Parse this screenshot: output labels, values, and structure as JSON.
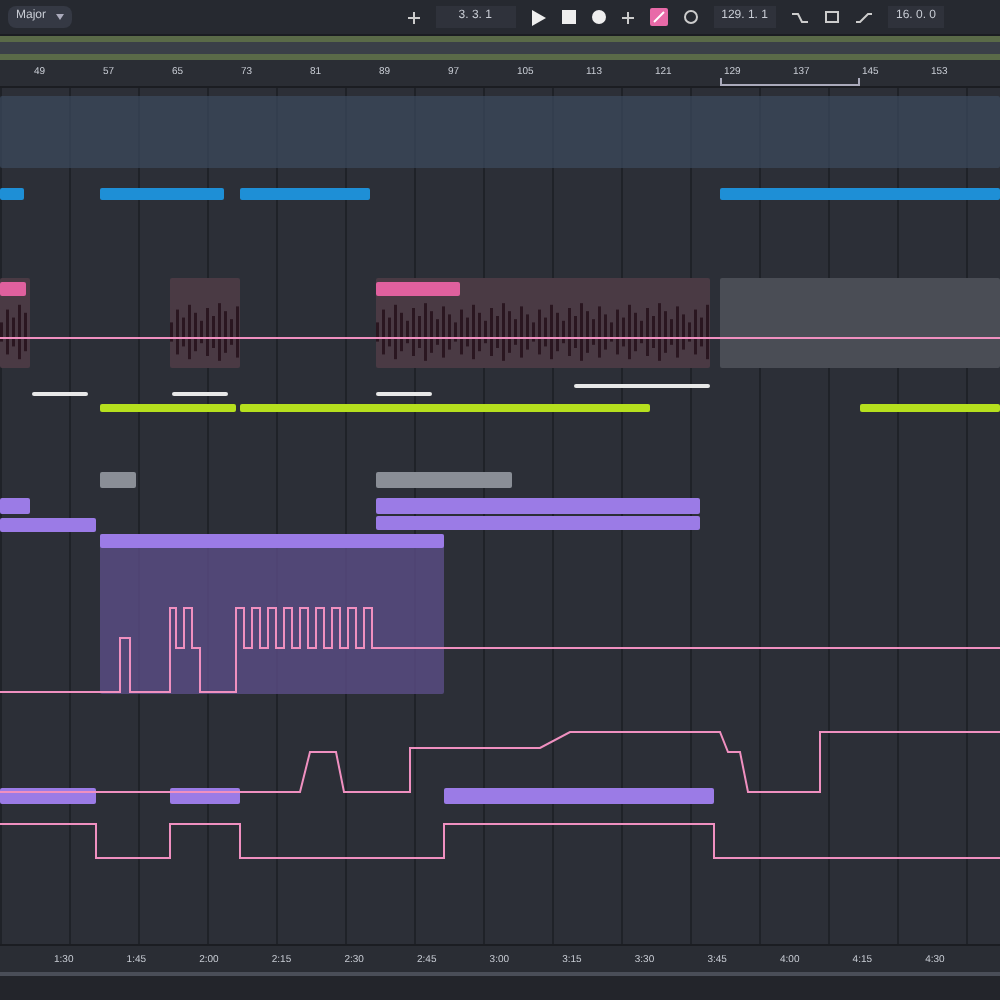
{
  "toolbar": {
    "scale": "Major",
    "position": "3. 3. 1",
    "loop_enabled": true,
    "loop_start": "129. 1. 1",
    "loop_length": "16. 0. 0"
  },
  "ruler": {
    "bars": [
      "49",
      "57",
      "65",
      "73",
      "81",
      "89",
      "97",
      "105",
      "113",
      "121",
      "129",
      "137",
      "145",
      "153"
    ]
  },
  "timeline": {
    "times": [
      "1:30",
      "1:45",
      "2:00",
      "2:15",
      "2:30",
      "2:45",
      "3:00",
      "3:15",
      "3:30",
      "3:45",
      "4:00",
      "4:15",
      "4:30"
    ]
  }
}
